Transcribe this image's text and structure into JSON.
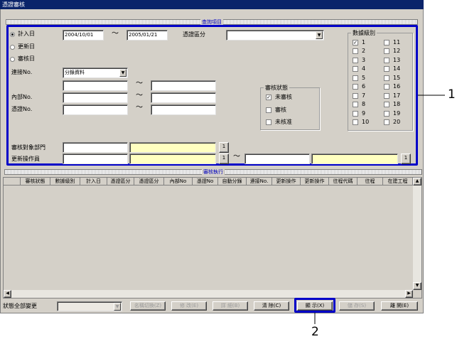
{
  "window": {
    "title": "憑證審核"
  },
  "sections": {
    "criteria": "查詢項目",
    "results": "審核執行"
  },
  "date_mode": {
    "options": [
      {
        "label": "計入日",
        "selected": true
      },
      {
        "label": "更新日",
        "selected": false
      },
      {
        "label": "審核日",
        "selected": false
      }
    ],
    "from": "2004/10/01",
    "to": "2005/01/21",
    "tilde": "～"
  },
  "voucher_category": {
    "label": "憑證區分",
    "value": ""
  },
  "link_no": {
    "label": "連接No.",
    "value": "分錄資料"
  },
  "internal_no": {
    "label": "內部No."
  },
  "voucher_no": {
    "label": "憑證No."
  },
  "audit_status": {
    "title": "審核狀態",
    "options": [
      {
        "label": "未審核",
        "checked": true
      },
      {
        "label": "審核",
        "checked": false
      },
      {
        "label": "未核准",
        "checked": false
      }
    ]
  },
  "data_level": {
    "title": "數據級別",
    "left": [
      {
        "label": "1",
        "checked": true
      },
      {
        "label": "2",
        "checked": false
      },
      {
        "label": "3",
        "checked": false
      },
      {
        "label": "4",
        "checked": false
      },
      {
        "label": "5",
        "checked": false
      },
      {
        "label": "6",
        "checked": false
      },
      {
        "label": "7",
        "checked": false
      },
      {
        "label": "8",
        "checked": false
      },
      {
        "label": "9",
        "checked": false
      },
      {
        "label": "10",
        "checked": false
      }
    ],
    "right": [
      {
        "label": "11",
        "checked": false
      },
      {
        "label": "12",
        "checked": false
      },
      {
        "label": "13",
        "checked": false
      },
      {
        "label": "14",
        "checked": false
      },
      {
        "label": "15",
        "checked": false
      },
      {
        "label": "16",
        "checked": false
      },
      {
        "label": "17",
        "checked": false
      },
      {
        "label": "18",
        "checked": false
      },
      {
        "label": "19",
        "checked": false
      },
      {
        "label": "20",
        "checked": false
      }
    ]
  },
  "audit_dept": {
    "label": "審核對象部門",
    "lookup": "1"
  },
  "updater": {
    "label": "更新操作員",
    "lookup": "1"
  },
  "table": {
    "columns": [
      "審核狀態",
      "數據級別",
      "計入日",
      "憑證區分",
      "憑證區分",
      "內部No",
      "憑證No",
      "自動分錄",
      "連接No.",
      "更新操作",
      "更新操作",
      "往程代碼",
      "往程",
      "在建工程"
    ]
  },
  "bottom": {
    "status_change_label": "狀態全部變更",
    "buttons": [
      {
        "label": "名稱切換(Z)",
        "enabled": false
      },
      {
        "label": "修 改(E)",
        "enabled": false
      },
      {
        "label": "詳 細(B)",
        "enabled": false
      },
      {
        "label": "清 除(C)",
        "enabled": true
      },
      {
        "label": "顯 示(X)",
        "enabled": true
      },
      {
        "label": "儲 存(S)",
        "enabled": false
      },
      {
        "label": "離 開(E)",
        "enabled": true
      }
    ]
  },
  "callouts": {
    "one": "1",
    "two": "2"
  },
  "colors": {
    "highlight": "#0000c8",
    "title_bar": "#0a246a",
    "face": "#d4d0c8",
    "yellow_field": "#ffffc0"
  }
}
